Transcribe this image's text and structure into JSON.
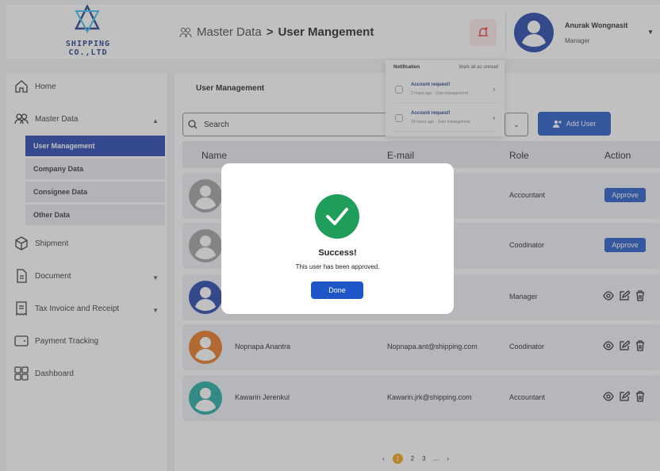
{
  "brand": {
    "company": "SHIPPING CO.,LTD"
  },
  "header": {
    "breadcrumb_parent": "Master Data",
    "breadcrumb_sep": ">",
    "breadcrumb_current": "User Mangement",
    "user_name": "Anurak Wongnasit",
    "user_role": "Manager"
  },
  "notifications": {
    "title": "Notification",
    "mark_all": "Mark all as unread",
    "items": [
      {
        "title": "Account request!",
        "meta": "2 hours ago · User management"
      },
      {
        "title": "Account request!",
        "meta": "18 hours ago · User management"
      }
    ]
  },
  "sidebar": {
    "items": [
      {
        "label": "Home"
      },
      {
        "label": "Master Data"
      },
      {
        "label": "Shipment"
      },
      {
        "label": "Document"
      },
      {
        "label": "Tax Invoice and Receipt"
      },
      {
        "label": "Payment Tracking"
      },
      {
        "label": "Dashboard"
      }
    ],
    "sub_items": [
      {
        "label": "User Management"
      },
      {
        "label": "Company Data"
      },
      {
        "label": "Consignee Data"
      },
      {
        "label": "Other Data"
      }
    ]
  },
  "main": {
    "tab_label": "User Management",
    "search_placeholder": "Search",
    "add_user_label": "Add User",
    "columns": [
      "Name",
      "E-mail",
      "Role",
      "Action"
    ],
    "approve_label": "Approve",
    "rows": [
      {
        "name": "",
        "email": "ing.com",
        "role": "Accountant",
        "action": "approve",
        "avatar_color": "#9e9e9e"
      },
      {
        "name": "",
        "email": "pping.com",
        "role": "Coodinator",
        "action": "approve",
        "avatar_color": "#9e9e9e"
      },
      {
        "name": "",
        "email": "ng.com",
        "role": "Manager",
        "action": "icons",
        "avatar_color": "#1e3fa8"
      },
      {
        "name": "Nopnapa Anantra",
        "email": "Nopnapa.ant@shipping.com",
        "role": "Coodinator",
        "action": "icons",
        "avatar_color": "#e8741a"
      },
      {
        "name": "Kawarin Jerenkul",
        "email": "Kawarin.jrk@shipping.com",
        "role": "Accountant",
        "action": "icons",
        "avatar_color": "#1ea89e"
      }
    ],
    "pager": {
      "prev": "‹",
      "pages": [
        "1",
        "2",
        "3",
        "..."
      ],
      "next": "›"
    }
  },
  "modal": {
    "title": "Success!",
    "message": "This user has been approved.",
    "button": "Done"
  },
  "colors": {
    "primary": "#1e56c8",
    "success": "#1e9e5a",
    "accent": "#f59e0b"
  }
}
